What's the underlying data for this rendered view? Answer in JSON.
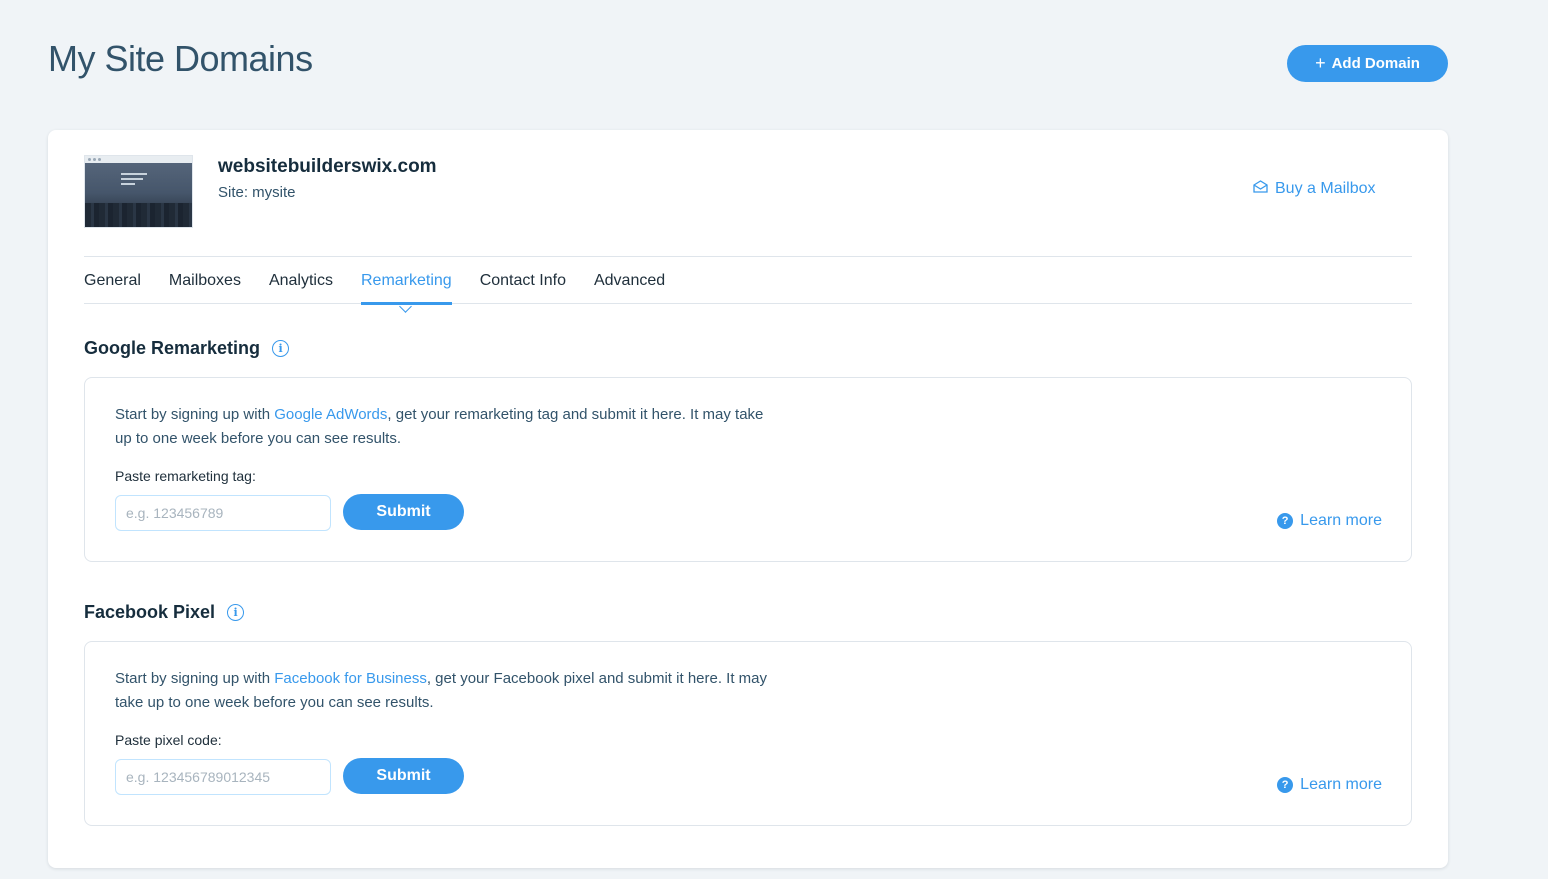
{
  "header": {
    "title": "My Site Domains",
    "add_domain_label": "Add Domain"
  },
  "domain": {
    "name": "websitebuilderswix.com",
    "site_line": "Site: mysite",
    "buy_mailbox_label": "Buy a Mailbox"
  },
  "tabs": [
    {
      "label": "General"
    },
    {
      "label": "Mailboxes"
    },
    {
      "label": "Analytics"
    },
    {
      "label": "Remarketing",
      "active": true
    },
    {
      "label": "Contact Info"
    },
    {
      "label": "Advanced"
    }
  ],
  "google": {
    "title": "Google Remarketing",
    "desc_before": "Start by signing up with ",
    "link": "Google AdWords",
    "desc_after": ", get your remarketing tag and submit it here. It may take up to one week before you can see results.",
    "field_label": "Paste remarketing tag:",
    "placeholder": "e.g. 123456789",
    "value": "",
    "submit_label": "Submit",
    "learn_more": "Learn more"
  },
  "facebook": {
    "title": "Facebook Pixel",
    "desc_before": "Start by signing up with ",
    "link": "Facebook for Business",
    "desc_after": ", get your Facebook pixel and submit it here. It may take up to one week before you can see results.",
    "field_label": "Paste pixel code:",
    "placeholder": "e.g. 123456789012345",
    "value": "",
    "submit_label": "Submit",
    "learn_more": "Learn more"
  },
  "colors": {
    "accent": "#3899ec",
    "background": "#f0f4f7",
    "text_dark": "#162d3d"
  }
}
